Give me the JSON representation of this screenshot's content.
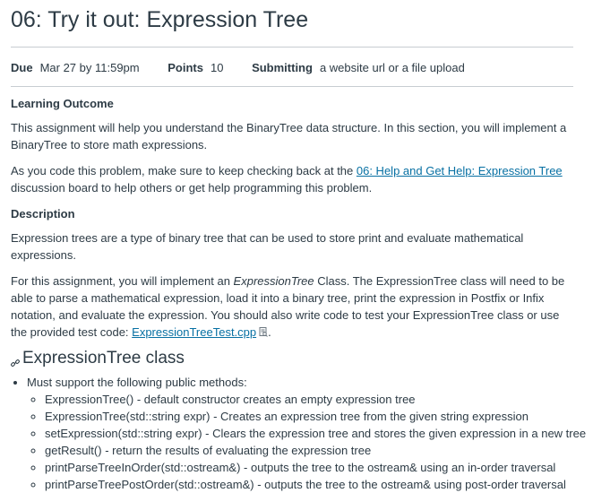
{
  "header": {
    "title": "06: Try it out: Expression Tree"
  },
  "meta": {
    "due_label": "Due",
    "due_value": "Mar 27 by 11:59pm",
    "points_label": "Points",
    "points_value": "10",
    "submitting_label": "Submitting",
    "submitting_value": "a website url or a file upload"
  },
  "content": {
    "learning_outcome_heading": "Learning Outcome",
    "p1": "This assignment will help you understand the BinaryTree data structure.  In this section, you will implement a BinaryTree to store math expressions.",
    "p2_before": "As you code this problem, make sure to keep checking back at the ",
    "p2_link": "06: Help and Get Help: Expression Tree",
    "p2_after": " discussion board to help others or get help programming this problem.",
    "description_heading": "Description",
    "p3": "Expression trees are a type of binary tree that can be used to store print and evaluate mathematical expressions.",
    "p4_before": "For this assignment, you will implement an ",
    "p4_em": "ExpressionTree",
    "p4_middle": " Class. The ExpressionTree class will need to be able to parse a mathematical expression, load it into a binary tree, print the expression in Postfix or Infix notation, and evaluate the expression.  You should also write code to test your ExpressionTree class or use the provided test code: ",
    "p4_link": "ExpressionTreeTest.cpp",
    "p4_after": ".",
    "section_title": "ExpressionTree class",
    "list_intro": "Must support the following public methods:",
    "methods": [
      "ExpressionTree() - default constructor creates an empty expression tree",
      "ExpressionTree(std::string expr) - Creates an expression tree from the given string expression",
      "setExpression(std::string expr) - Clears the expression tree and stores the given expression in a new tree",
      "getResult() - return the results of evaluating the expression tree",
      "printParseTreeInOrder(std::ostream&) - outputs the tree to the ostream& using an in-order traversal",
      "printParseTreePostOrder(std::ostream&) - outputs the tree to the ostream& using post-order traversal"
    ]
  }
}
